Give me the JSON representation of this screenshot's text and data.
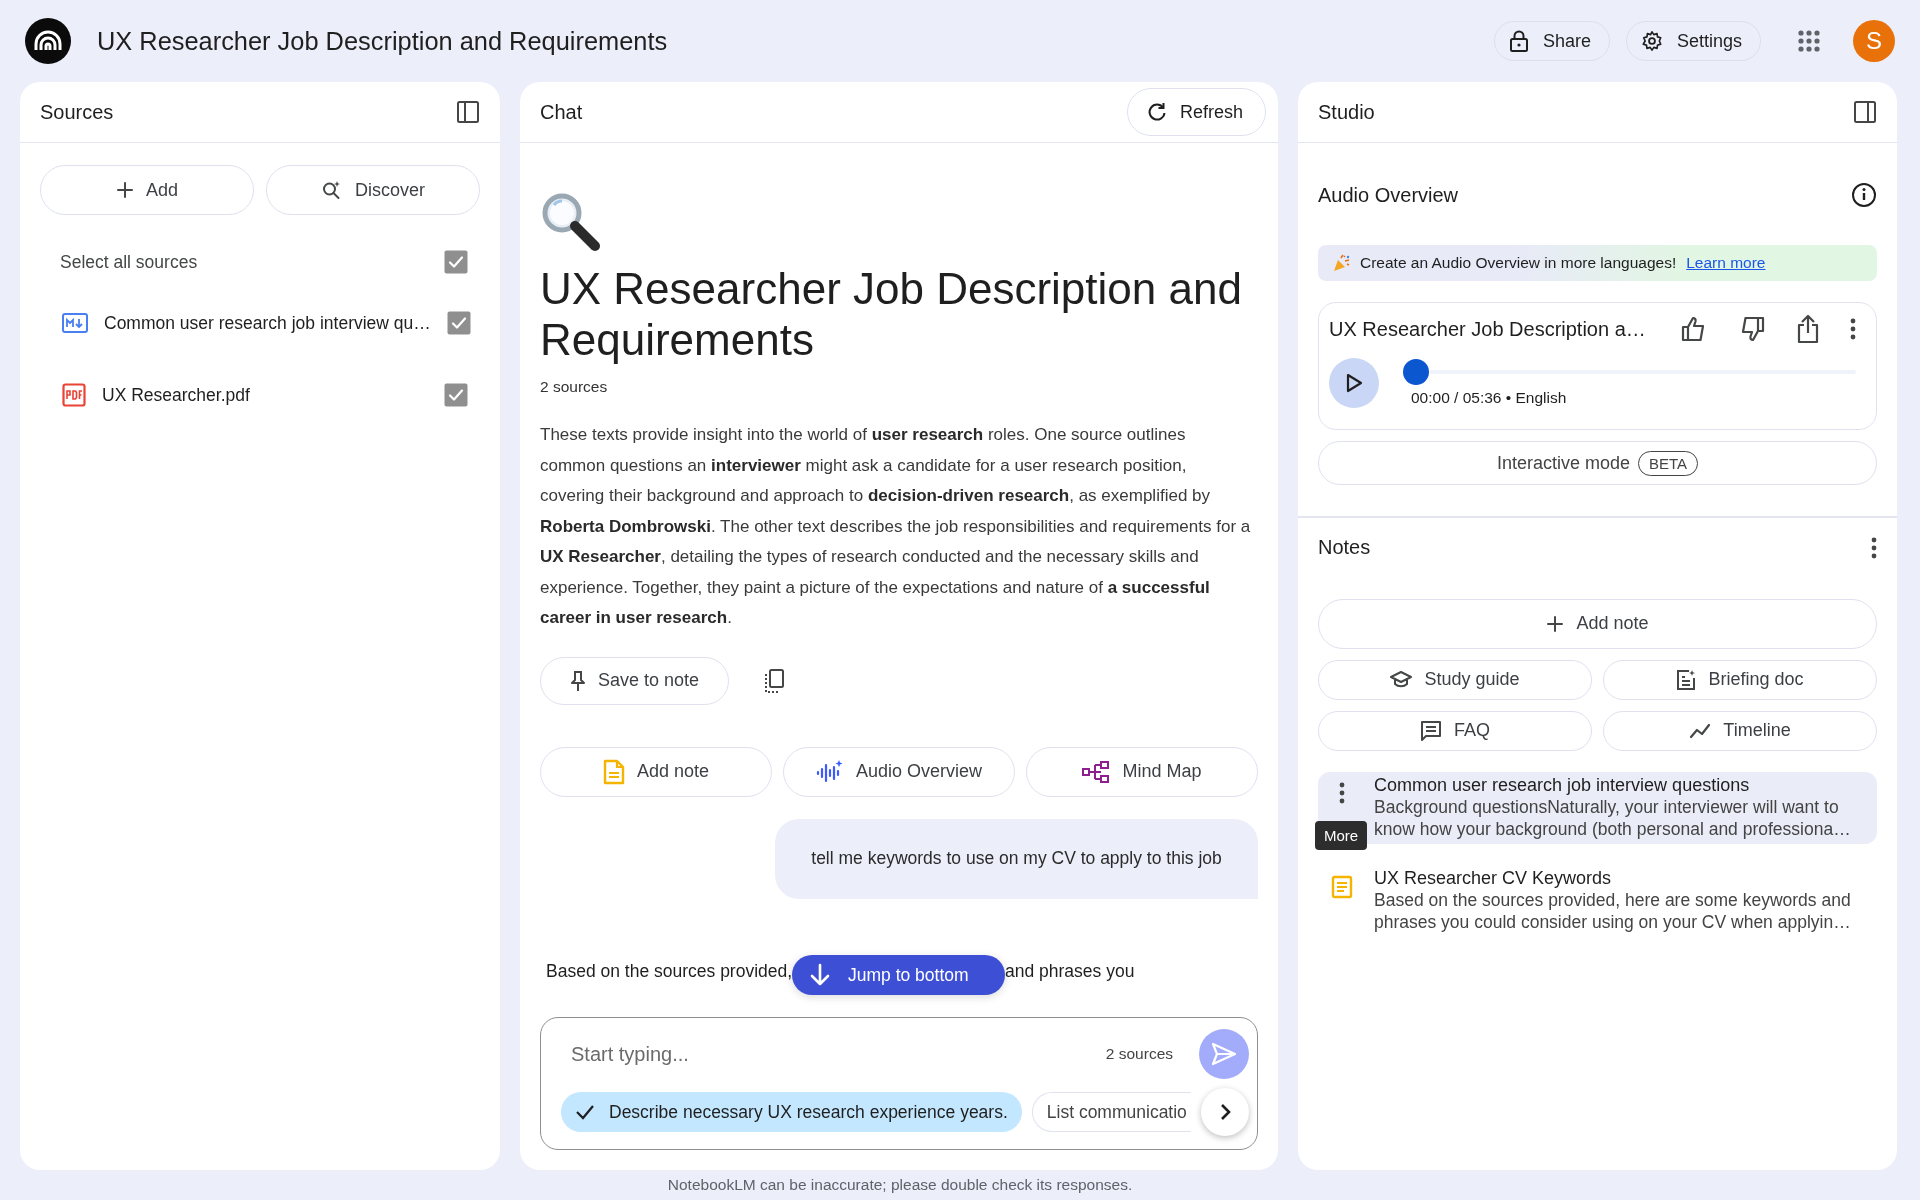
{
  "header": {
    "title": "UX Researcher Job Description and Requirements",
    "share_label": "Share",
    "settings_label": "Settings",
    "avatar_initial": "S"
  },
  "sources": {
    "title": "Sources",
    "add_label": "Add",
    "discover_label": "Discover",
    "select_all": {
      "label": "Select all sources",
      "checked": true
    },
    "items": [
      {
        "kind": "markdown",
        "name": "Common user research job interview qu…",
        "checked": true
      },
      {
        "kind": "pdf",
        "name": "UX Researcher.pdf",
        "checked": true
      }
    ]
  },
  "chat": {
    "title": "Chat",
    "refresh_label": "Refresh",
    "notebook_title": "UX Researcher Job Description and Requirements",
    "source_count": "2 sources",
    "summary": "These texts provide insight into the world of **user research** roles. One source outlines common questions an **interviewer** might ask a candidate for a user research position, covering their background and approach to **decision-driven research**, as exemplified by **Roberta Dombrowski**. The other text describes the job responsibilities and requirements for a **UX Researcher**, detailing the types of research conducted and the necessary skills and experience. Together, they paint a picture of the expectations and nature of **a successful career in user research**.",
    "save_to_note_label": "Save to note",
    "actions": [
      {
        "kind": "note",
        "label": "Add note"
      },
      {
        "kind": "audio",
        "label": "Audio Overview"
      },
      {
        "kind": "mindmap",
        "label": "Mind Map"
      }
    ],
    "user_message": "tell me keywords to use on my CV to apply to this job",
    "response_parts": [
      "Based on the sources provided,",
      "and phrases you"
    ],
    "jump_label": "Jump to bottom",
    "input": {
      "placeholder": "Start typing...",
      "source_count": "2 sources"
    },
    "suggestions": [
      {
        "label": "Describe necessary UX research experience years.",
        "selected": true
      },
      {
        "label": "List communicatio",
        "selected": false
      }
    ]
  },
  "studio": {
    "title": "Studio",
    "audio": {
      "title": "Audio Overview",
      "banner_text": "Create an Audio Overview in more languages!",
      "banner_link": "Learn more",
      "card_title": "UX Researcher Job Description a…",
      "time": "00:00 / 05:36 • English",
      "level": 0,
      "interactive_label": "Interactive mode",
      "interactive_badge": "BETA"
    },
    "notes": {
      "title": "Notes",
      "add_label": "Add note",
      "tools": [
        {
          "kind": "study",
          "label": "Study guide"
        },
        {
          "kind": "briefing",
          "label": "Briefing doc"
        },
        {
          "kind": "faq",
          "label": "FAQ"
        },
        {
          "kind": "timeline",
          "label": "Timeline"
        }
      ],
      "items": [
        {
          "title": "Common user research job interview questions",
          "preview": "Background questionsNaturally, your interviewer will want to know how your background (both personal and professiona…",
          "selected": true
        },
        {
          "title": "UX Researcher CV Keywords",
          "preview": "Based on the sources provided, here are some keywords and phrases you could consider using on your CV when applyin…",
          "selected": false
        }
      ],
      "tooltip": "More"
    }
  },
  "footer": "NotebookLM can be inaccurate; please double check its responses."
}
